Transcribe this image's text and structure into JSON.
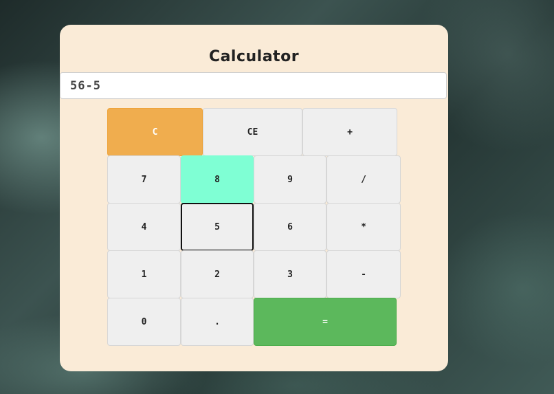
{
  "calculator": {
    "title": "Calculator",
    "display_value": "56-5",
    "buttons": {
      "clear": "C",
      "clear_entry": "CE",
      "plus": "+",
      "seven": "7",
      "eight": "8",
      "nine": "9",
      "divide": "/",
      "four": "4",
      "five": "5",
      "six": "6",
      "multiply": "*",
      "one": "1",
      "two": "2",
      "three": "3",
      "minus": "-",
      "zero": "0",
      "decimal": ".",
      "equals": "="
    }
  },
  "colors": {
    "card_background": "#faebd7",
    "clear_button": "#f0ad4e",
    "highlighted_button": "#7fffd4",
    "equals_button": "#5cb85c",
    "default_button": "#efefef"
  }
}
